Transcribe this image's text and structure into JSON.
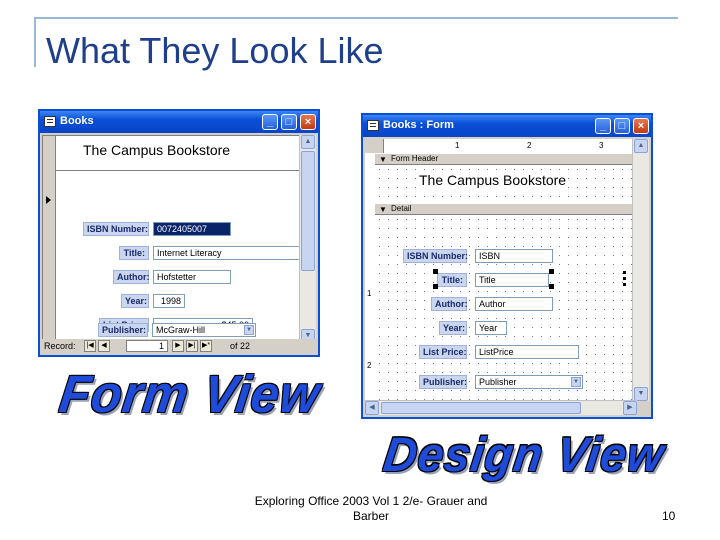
{
  "slide": {
    "title": "What They Look Like",
    "footer": "Exploring Office 2003 Vol 1 2/e- Grauer and Barber",
    "page_number": "10"
  },
  "form_view": {
    "window_title": "Books",
    "header": "The Campus Bookstore",
    "fields": [
      {
        "label": "ISBN Number:",
        "value": "0072405007"
      },
      {
        "label": "Title:",
        "value": "Internet Literacy"
      },
      {
        "label": "Author:",
        "value": "Hofstetter"
      },
      {
        "label": "Year:",
        "value": "1998"
      },
      {
        "label": "List Price:",
        "value": "$45.00"
      },
      {
        "label": "Publisher:",
        "value": "McGraw-Hill"
      }
    ],
    "record_nav": {
      "label": "Record:",
      "current": "1",
      "of": "of  22"
    },
    "caption": "Form View"
  },
  "design_view": {
    "window_title": "Books : Form",
    "section_header": "Form Header",
    "section_detail": "Detail",
    "header_label": "The Campus Bookstore",
    "ruler_top": [
      "1",
      "2",
      "3"
    ],
    "ruler_left": [
      "1",
      "2"
    ],
    "fields": [
      {
        "label": "ISBN Number:",
        "value": "ISBN"
      },
      {
        "label": "Title:",
        "value": "Title"
      },
      {
        "label": "Author:",
        "value": "Author"
      },
      {
        "label": "Year:",
        "value": "Year"
      },
      {
        "label": "List Price:",
        "value": "ListPrice"
      },
      {
        "label": "Publisher:",
        "value": "Publisher"
      }
    ],
    "caption": "Design View"
  },
  "icons": {
    "titlebar": [
      "minimize-icon",
      "maximize-icon",
      "close-icon"
    ]
  },
  "colors": {
    "title": "#1f3f8a",
    "wordart": "#1e4bd8",
    "xp_titlebar": "#0a4fd6",
    "label_bg": "#c9d6ee"
  }
}
